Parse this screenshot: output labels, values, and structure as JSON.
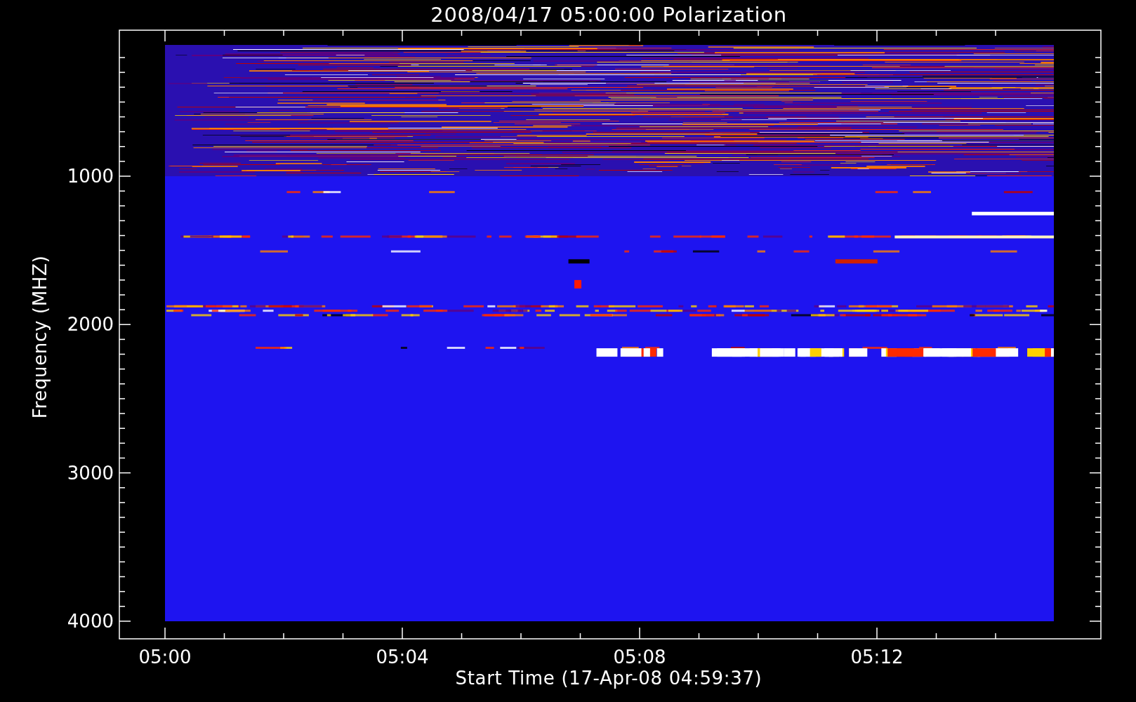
{
  "title": "2008/04/17 05:00:00 Polarization",
  "plot": {
    "ylabel": "Frequency (MHZ)",
    "xlabel": "Start Time (17-Apr-08 04:59:37)",
    "yticks": [
      "1000",
      "2000",
      "3000",
      "4000"
    ],
    "xticks": [
      "05:00",
      "05:04",
      "05:08",
      "05:12"
    ]
  }
}
